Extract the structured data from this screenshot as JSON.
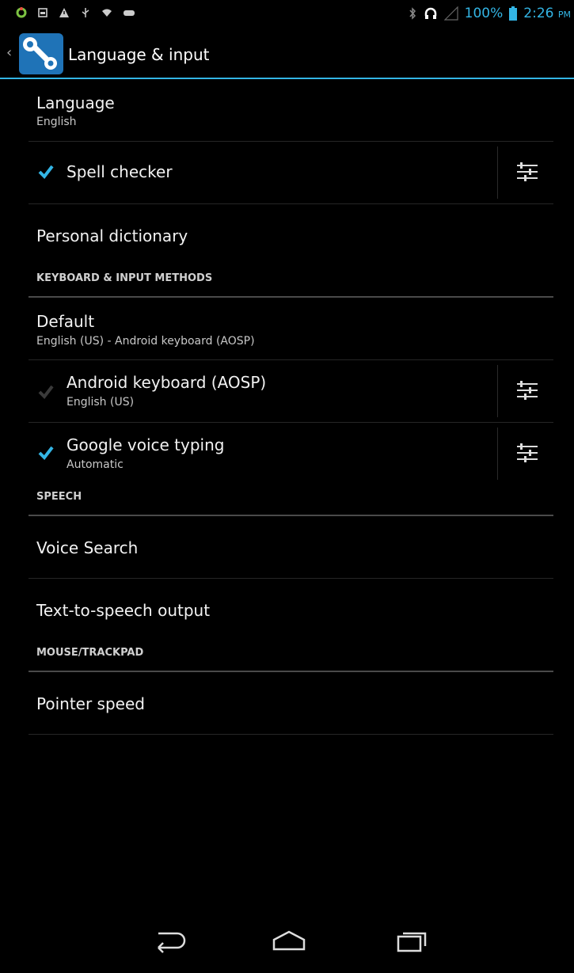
{
  "status_bar": {
    "battery": "100%",
    "time": "2:26",
    "ampm": "PM",
    "icons_left": [
      "sync-icon",
      "sim-icon",
      "warning-icon",
      "usb-icon",
      "wifi-icon",
      "gamepad-icon"
    ],
    "icons_right": [
      "bluetooth-icon",
      "headset-icon",
      "signal-icon",
      "battery-icon"
    ]
  },
  "action_bar": {
    "title": "Language & input"
  },
  "settings": {
    "language": {
      "title": "Language",
      "summary": "English"
    },
    "spell_checker": {
      "title": "Spell checker",
      "checked": true
    },
    "personal_dictionary": {
      "title": "Personal dictionary"
    },
    "header_keyboard": "KEYBOARD & INPUT METHODS",
    "default": {
      "title": "Default",
      "summary": "English (US) - Android keyboard (AOSP)"
    },
    "android_keyboard": {
      "title": "Android keyboard (AOSP)",
      "summary": "English (US)",
      "checked": true,
      "enabled": false
    },
    "google_voice": {
      "title": "Google voice typing",
      "summary": "Automatic",
      "checked": true
    },
    "header_speech": "SPEECH",
    "voice_search": {
      "title": "Voice Search"
    },
    "tts": {
      "title": "Text-to-speech output"
    },
    "header_mouse": "MOUSE/TRACKPAD",
    "pointer_speed": {
      "title": "Pointer speed"
    }
  },
  "nav_bar": {
    "buttons": [
      "back-icon",
      "home-icon",
      "recent-apps-icon"
    ]
  },
  "colors": {
    "accent": "#33b5e5",
    "background": "#000000",
    "icon_bg": "#1f73b7"
  }
}
